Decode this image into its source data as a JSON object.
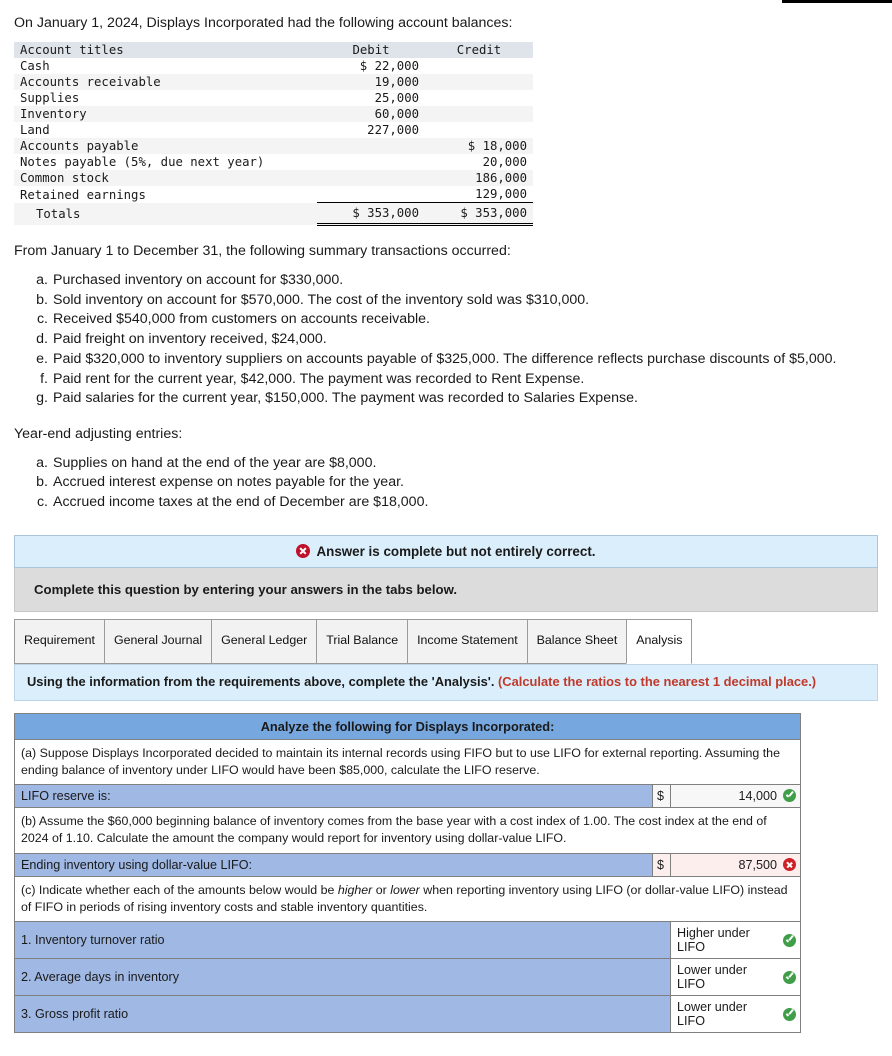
{
  "intro": "On January 1, 2024, Displays Incorporated had the following account balances:",
  "balances_table": {
    "headers": [
      "Account titles",
      "Debit",
      "Credit"
    ],
    "rows": [
      {
        "account": "Cash",
        "debit": "$ 22,000",
        "credit": ""
      },
      {
        "account": "Accounts receivable",
        "debit": "19,000",
        "credit": ""
      },
      {
        "account": "Supplies",
        "debit": "25,000",
        "credit": ""
      },
      {
        "account": "Inventory",
        "debit": "60,000",
        "credit": ""
      },
      {
        "account": "Land",
        "debit": "227,000",
        "credit": ""
      },
      {
        "account": "Accounts payable",
        "debit": "",
        "credit": "$ 18,000"
      },
      {
        "account": "Notes payable (5%, due next year)",
        "debit": "",
        "credit": "20,000"
      },
      {
        "account": "Common stock",
        "debit": "",
        "credit": "186,000"
      },
      {
        "account": "Retained earnings",
        "debit": "",
        "credit": "129,000"
      }
    ],
    "totals": {
      "account": "Totals",
      "debit": "$ 353,000",
      "credit": "$ 353,000"
    }
  },
  "transactions_heading": "From January 1 to December 31, the following summary transactions occurred:",
  "transactions": [
    {
      "marker": "a.",
      "text": "Purchased inventory on account for $330,000."
    },
    {
      "marker": "b.",
      "text": "Sold inventory on account for $570,000. The cost of the inventory sold was $310,000."
    },
    {
      "marker": "c.",
      "text": "Received $540,000 from customers on accounts receivable."
    },
    {
      "marker": "d.",
      "text": "Paid freight on inventory received, $24,000."
    },
    {
      "marker": "e.",
      "text": "Paid $320,000 to inventory suppliers on accounts payable of $325,000. The difference reflects purchase discounts of $5,000."
    },
    {
      "marker": "f.",
      "text": "Paid rent for the current year, $42,000. The payment was recorded to Rent Expense."
    },
    {
      "marker": "g.",
      "text": "Paid salaries for the current year, $150,000. The payment was recorded to Salaries Expense."
    }
  ],
  "adjusting_heading": "Year-end adjusting entries:",
  "adjusting": [
    {
      "marker": "a.",
      "text": "Supplies on hand at the end of the year are $8,000."
    },
    {
      "marker": "b.",
      "text": "Accrued interest expense on notes payable for the year."
    },
    {
      "marker": "c.",
      "text": "Accrued income taxes at the end of December are $18,000."
    }
  ],
  "alert": {
    "icon": "error-circle-icon",
    "message": "Answer is complete but not entirely correct."
  },
  "gray_bar": "Complete this question by entering your answers in the tabs below.",
  "tabs": [
    {
      "label": "Requirement",
      "active": false
    },
    {
      "label": "General Journal",
      "active": false
    },
    {
      "label": "General Ledger",
      "active": false
    },
    {
      "label": "Trial Balance",
      "active": false
    },
    {
      "label": "Income Statement",
      "active": false
    },
    {
      "label": "Balance Sheet",
      "active": false
    },
    {
      "label": "Analysis",
      "active": true
    }
  ],
  "instruction": {
    "main": "Using the information from the requirements above, complete the 'Analysis'.",
    "hint": "(Calculate the ratios to the nearest 1 decimal place.)"
  },
  "analysis": {
    "header": "Analyze the following for Displays Incorporated:",
    "prompt_a": "(a) Suppose Displays Incorporated decided to maintain its internal records using FIFO but to use LIFO for external reporting. Assuming the ending balance of inventory under LIFO would have been $85,000, calculate the LIFO reserve.",
    "row_a": {
      "label": "LIFO reserve is:",
      "currency": "$",
      "value": "14,000",
      "status": "correct"
    },
    "prompt_b": "(b) Assume the $60,000 beginning balance of inventory comes from the base year with a cost index of 1.00. The cost index at the end of 2024 of 1.10. Calculate the amount the company would report for inventory using dollar-value LIFO.",
    "row_b": {
      "label": "Ending inventory using dollar-value LIFO:",
      "currency": "$",
      "value": "87,500",
      "status": "incorrect"
    },
    "prompt_c_pre": "(c) Indicate whether each of the amounts below would be ",
    "prompt_c_it1": "higher",
    "prompt_c_mid": " or ",
    "prompt_c_it2": "lower",
    "prompt_c_post": " when reporting inventory using LIFO (or dollar-value LIFO) instead of FIFO in periods of rising inventory costs and stable inventory quantities.",
    "rows_c": [
      {
        "label": "1. Inventory turnover ratio",
        "answer": "Higher under LIFO",
        "status": "correct"
      },
      {
        "label": "2. Average days in inventory",
        "answer": "Lower under LIFO",
        "status": "correct"
      },
      {
        "label": "3. Gross profit ratio",
        "answer": "Lower under LIFO",
        "status": "correct"
      }
    ]
  },
  "colors": {
    "header_blue": "#76a7df",
    "row_blue": "#9fb8e4",
    "info_bg": "#dbeefb",
    "hint_red": "#c0392b",
    "ok_green": "#3f9e47",
    "bad_red": "#cc2127"
  }
}
